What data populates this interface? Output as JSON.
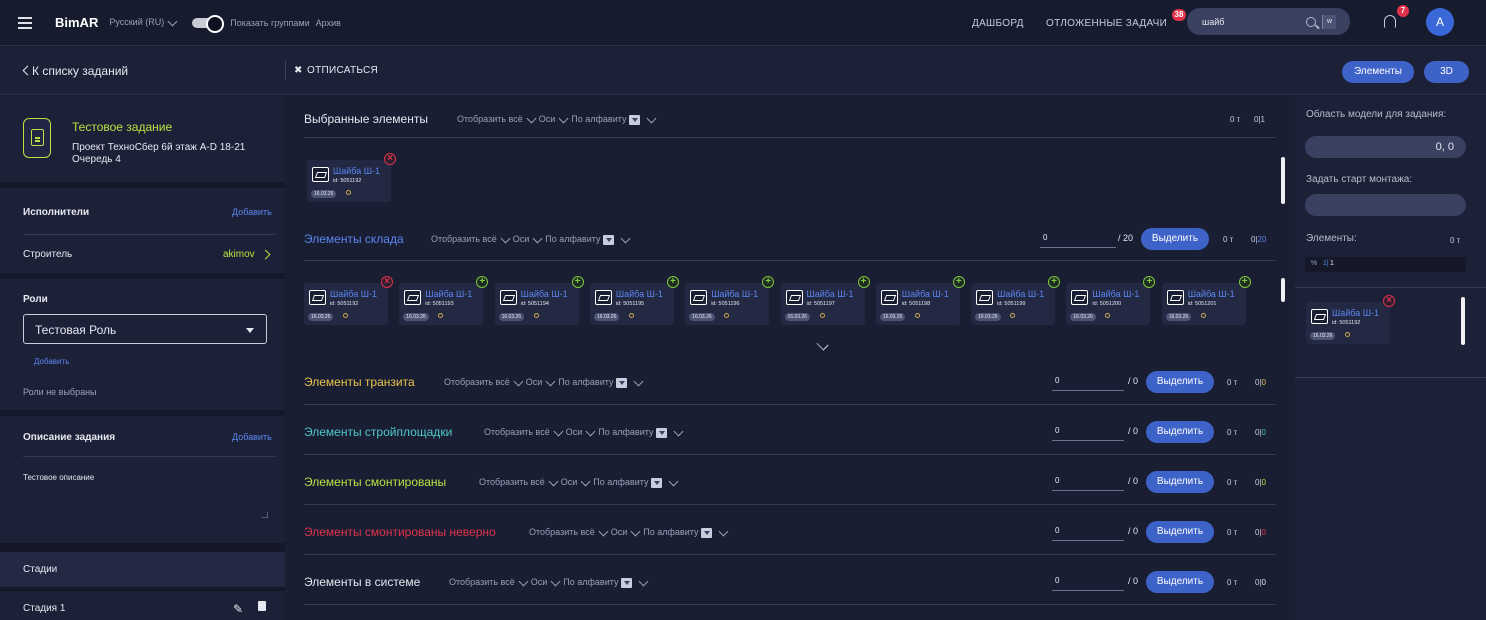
{
  "header": {
    "app_name": "BimAR",
    "language": "Русский (RU)",
    "group_toggle_label": "Показать группами",
    "archive_label": "Архив",
    "nav_dashboard": "ДАШБОРД",
    "nav_postponed": "ОТЛОЖЕННЫЕ ЗАДАЧИ",
    "postponed_badge": "38",
    "search_value": "шайб",
    "search_key": "w",
    "notifications_badge": "7",
    "avatar_letter": "A"
  },
  "subheader": {
    "back_label": "К списку заданий",
    "unsubscribe_label": "ОТПИСАТЬСЯ",
    "elements_button": "Элементы",
    "three_d_button": "3D"
  },
  "left_panel": {
    "task_title": "Тестовое задание",
    "project": "Проект ТехноСбер 6й этаж A-D 18-21",
    "queue": "Очередь 4",
    "executors_heading": "Исполнители",
    "executors_add": "Добавить",
    "builder_role": "Строитель",
    "builder_user": "akimov",
    "roles_heading": "Роли",
    "role_selected": "Тестовая Роль",
    "roles_add": "Добавить",
    "roles_empty": "Роли не выбраны",
    "description_heading": "Описание задания",
    "description_add": "Добавить",
    "description_text": "Тестовое описание",
    "stages_heading": "Стадии",
    "stage_1": "Стадия 1"
  },
  "sections": {
    "options": {
      "show_all": "Отобразить всё",
      "axes": "Оси",
      "alphabetical": "По алфавиту"
    },
    "selected": {
      "title": "Выбранные элементы",
      "count_t": "0 т",
      "count_ratio": "0|1",
      "color": "#e6e8f0"
    },
    "warehouse": {
      "title": "Элементы склада",
      "input": "0",
      "total": "/ 20",
      "select_btn": "Выделить",
      "count_t": "0 т",
      "count_a": "0|",
      "count_b": "20",
      "color": "#5b86f0"
    },
    "transit": {
      "title": "Элементы транзита",
      "input": "0",
      "total": "/ 0",
      "select_btn": "Выделить",
      "count_t": "0 т",
      "count_a": "0|",
      "count_b": "0",
      "color": "#e8c24a"
    },
    "site": {
      "title": "Элементы стройплощадки",
      "input": "0",
      "total": "/ 0",
      "select_btn": "Выделить",
      "count_t": "0 т",
      "count_a": "0|",
      "count_b": "0",
      "color": "#4fc8c8"
    },
    "mounted": {
      "title": "Элементы смонтированы",
      "input": "0",
      "total": "/ 0",
      "select_btn": "Выделить",
      "count_t": "0 т",
      "count_a": "0|",
      "count_b": "0",
      "color": "#b6e342"
    },
    "mounted_wrong": {
      "title": "Элементы смонтированы неверно",
      "input": "0",
      "total": "/ 0",
      "select_btn": "Выделить",
      "count_t": "0 т",
      "count_a": "0|",
      "count_b": "0",
      "color": "#e0334a"
    },
    "in_system": {
      "title": "Элементы в системе",
      "input": "0",
      "total": "/ 0",
      "select_btn": "Выделить",
      "count_t": "0 т",
      "count_a": "0|",
      "count_b": "0",
      "color": "#e6e8f0"
    }
  },
  "selected_cards": [
    {
      "name": "Шайба Ш-1",
      "id": "id: 5051192",
      "date": "16.03.26",
      "mark": "remove"
    }
  ],
  "warehouse_cards": [
    {
      "name": "Шайба Ш-1",
      "id": "id: 5051192",
      "date": "16.03.26",
      "mark": "remove"
    },
    {
      "name": "Шайба Ш-1",
      "id": "id: 5051193",
      "date": "16.03.26",
      "mark": "add"
    },
    {
      "name": "Шайба Ш-1",
      "id": "id: 5051194",
      "date": "16.03.26",
      "mark": "add"
    },
    {
      "name": "Шайба Ш-1",
      "id": "id: 5051195",
      "date": "16.03.26",
      "mark": "add"
    },
    {
      "name": "Шайба Ш-1",
      "id": "id: 5051196",
      "date": "16.03.26",
      "mark": "add"
    },
    {
      "name": "Шайба Ш-1",
      "id": "id: 5051197",
      "date": "16.03.26",
      "mark": "add"
    },
    {
      "name": "Шайба Ш-1",
      "id": "id: 5051198",
      "date": "16.03.26",
      "mark": "add"
    },
    {
      "name": "Шайба Ш-1",
      "id": "id: 5051199",
      "date": "16.03.26",
      "mark": "add"
    },
    {
      "name": "Шайба Ш-1",
      "id": "id: 5051200",
      "date": "16.03.26",
      "mark": "add"
    },
    {
      "name": "Шайба Ш-1",
      "id": "id: 5051201",
      "date": "16.03.26",
      "mark": "add"
    }
  ],
  "right_panel": {
    "model_area_label": "Область модели для задания:",
    "model_area_value": "0, 0",
    "start_mount_label": "Задать старт монтажа:",
    "elements_label": "Элементы:",
    "elements_weight": "0 т",
    "percent_sign": "%",
    "percent_sep": "1|",
    "percent_value": "1",
    "card": {
      "name": "Шайба Ш-1",
      "id": "id: 5051192",
      "date": "16.03.26",
      "mark": "remove"
    }
  }
}
